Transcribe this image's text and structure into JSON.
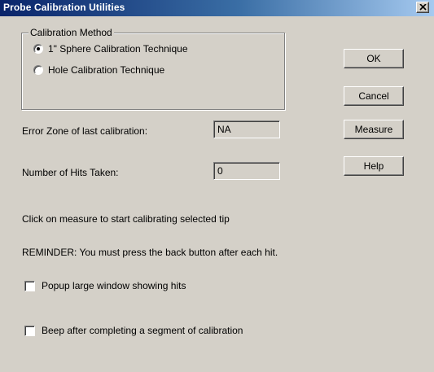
{
  "window": {
    "title": "Probe Calibration Utilities"
  },
  "calibration_method": {
    "label": "Calibration Method",
    "options": [
      {
        "label": "1\" Sphere Calibration Technique",
        "selected": true
      },
      {
        "label": "Hole Calibration Technique",
        "selected": false
      }
    ]
  },
  "fields": {
    "error_zone": {
      "label": "Error Zone of last calibration:",
      "value": "NA"
    },
    "hits_taken": {
      "label": "Number of Hits Taken:",
      "value": "0"
    }
  },
  "buttons": {
    "ok": "OK",
    "cancel": "Cancel",
    "measure": "Measure",
    "help": "Help"
  },
  "messages": {
    "instruction": "Click on measure to start calibrating selected tip",
    "reminder": "REMINDER:  You must press the back button after each hit."
  },
  "options": {
    "popup_window": {
      "label": "Popup large window showing hits",
      "checked": false
    },
    "beep": {
      "label": "Beep after completing a segment of calibration",
      "checked": false
    }
  },
  "icons": {
    "close": "close-icon"
  },
  "colors": {
    "title_bar_start": "#0a246a",
    "title_bar_end": "#a6caf0",
    "dialog_face": "#d4d0c8"
  }
}
